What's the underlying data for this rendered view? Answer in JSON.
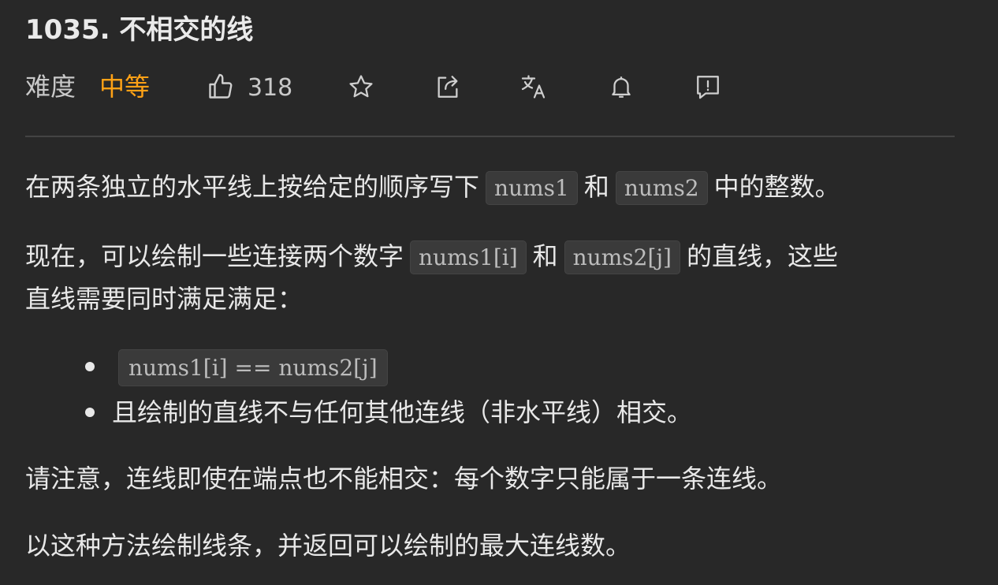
{
  "problem": {
    "title": "1035. 不相交的线",
    "difficulty_label": "难度",
    "difficulty_value": "中等",
    "like_count": "318"
  },
  "toolbar": {
    "icons": [
      "thumbs-up-icon",
      "star-icon",
      "share-icon",
      "translate-icon",
      "bell-icon",
      "feedback-icon"
    ]
  },
  "description": {
    "p1_before": "在两条独立的水平线上按给定的顺序写下",
    "p1_code1": "nums1",
    "p1_mid": "和",
    "p1_code2": "nums2",
    "p1_after": "中的整数。",
    "p2_before": "现在，可以绘制一些连接两个数字",
    "p2_code1": "nums1[i]",
    "p2_mid": "和",
    "p2_code2": "nums2[j]",
    "p2_after": "的直线，这些",
    "p2_line2": "直线需要同时满足满足：",
    "list_item1_code": "nums1[i] == nums2[j]",
    "list_item2": "且绘制的直线不与任何其他连线（非水平线）相交。",
    "p3": "请注意，连线即使在端点也不能相交：每个数字只能属于一条连线。",
    "p4": "以这种方法绘制线条，并返回可以绘制的最大连线数。"
  },
  "colors": {
    "background": "#282828",
    "difficulty_medium": "#ffa116",
    "text": "#e8e8e8"
  }
}
